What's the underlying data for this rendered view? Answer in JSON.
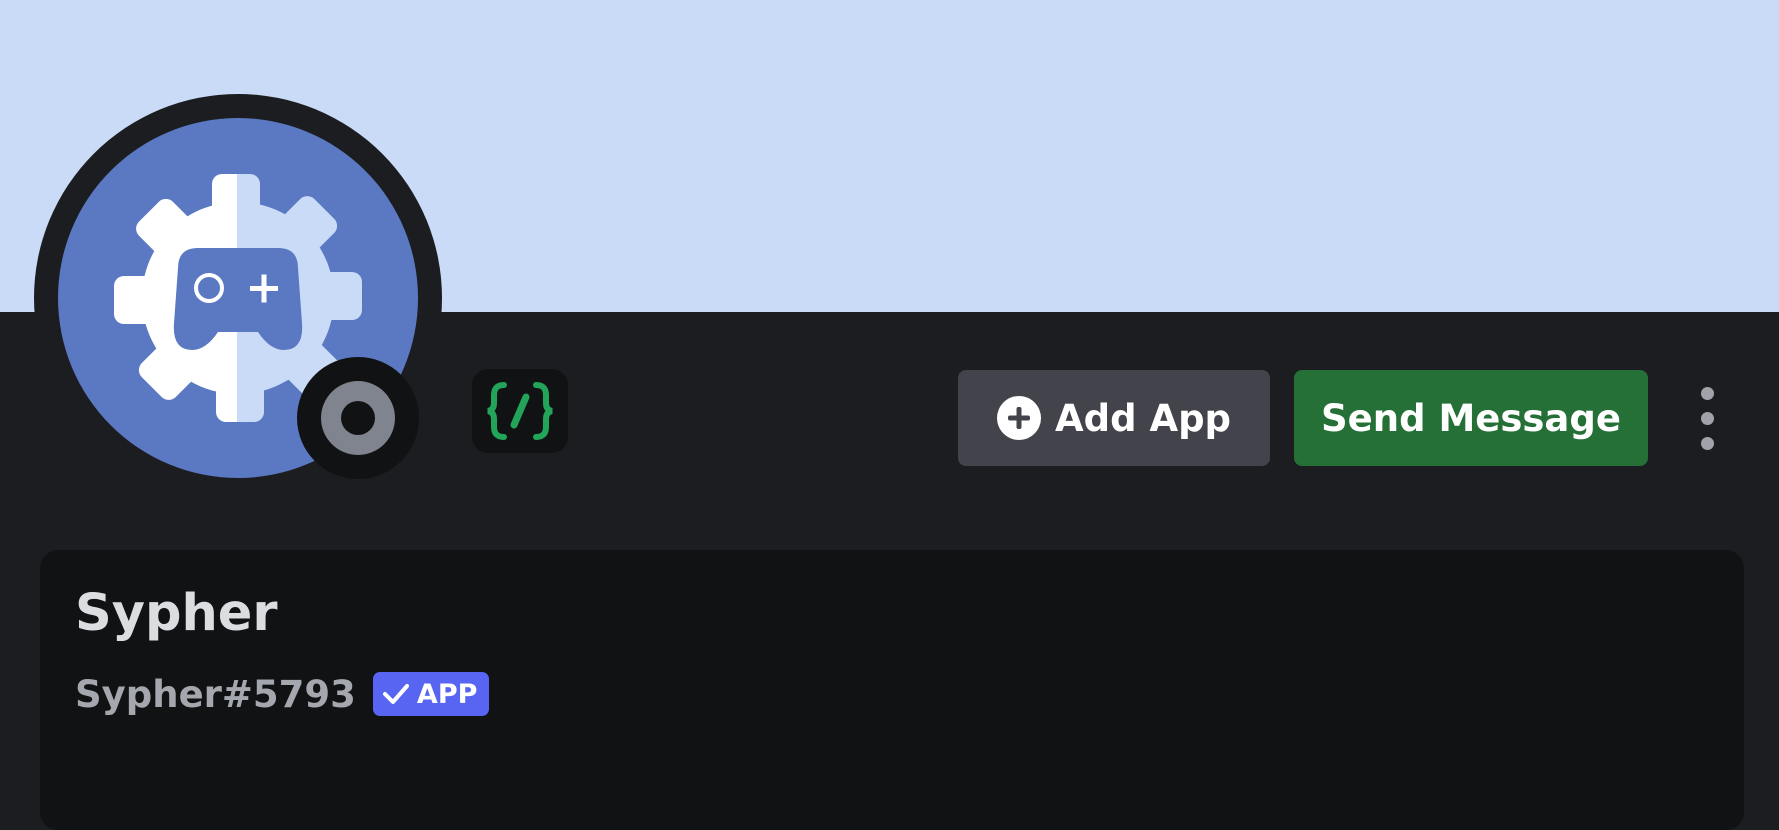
{
  "profile": {
    "display_name": "Sypher",
    "username": "Sypher#5793",
    "badge_label": "APP",
    "status": "offline"
  },
  "actions": {
    "add_app_label": "Add App",
    "send_message_label": "Send Message",
    "more_icon": "vertical-ellipsis-icon",
    "add_icon": "plus-circle-icon"
  },
  "icons": {
    "avatar": "gear-gamepad-icon",
    "slash_commands": "slash-commands-icon",
    "verified": "checkmark-icon"
  },
  "colors": {
    "banner": "#c9dbf6",
    "background": "#1c1d21",
    "card": "#111214",
    "avatar_bg": "#5b79c2",
    "send_button": "#257036",
    "add_button": "#43444b",
    "app_badge": "#5865f2",
    "slash_icon": "#23a559",
    "status_offline": "#80848e"
  }
}
